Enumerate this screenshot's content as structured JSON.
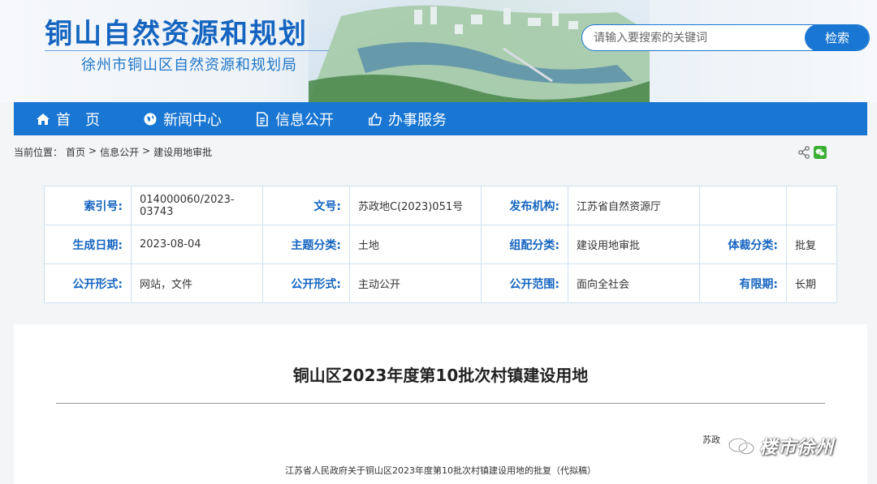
{
  "header": {
    "site_title": "铜山自然资源和规划",
    "site_subtitle": "徐州市铜山区自然资源和规划局"
  },
  "search": {
    "placeholder": "请输入要搜索的关键词",
    "button_label": "检索"
  },
  "nav": {
    "items": [
      {
        "label": "首　页",
        "icon": "home-icon"
      },
      {
        "label": "新闻中心",
        "icon": "globe-icon"
      },
      {
        "label": "信息公开",
        "icon": "document-icon"
      },
      {
        "label": "办事服务",
        "icon": "thumbs-up-icon"
      }
    ]
  },
  "breadcrumb": {
    "prefix": "当前位置：",
    "items": [
      "首页",
      "信息公开",
      "建设用地审批"
    ],
    "separator": ">"
  },
  "meta": {
    "rows": [
      [
        {
          "k": "索引号:",
          "v": "014000060/2023-03743"
        },
        {
          "k": "文号:",
          "v": "苏政地C(2023)051号"
        },
        {
          "k": "发布机构:",
          "v": "江苏省自然资源厅"
        },
        {
          "k": "",
          "v": ""
        }
      ],
      [
        {
          "k": "生成日期:",
          "v": "2023-08-04"
        },
        {
          "k": "主题分类:",
          "v": "土地"
        },
        {
          "k": "组配分类:",
          "v": "建设用地审批"
        },
        {
          "k": "体裁分类:",
          "v": "批复"
        }
      ],
      [
        {
          "k": "公开形式:",
          "v": "网站，文件"
        },
        {
          "k": "公开形式:",
          "v": "主动公开"
        },
        {
          "k": "公开范围:",
          "v": "面向全社会"
        },
        {
          "k": "有限期:",
          "v": "长期"
        }
      ]
    ]
  },
  "article": {
    "title": "铜山区2023年度第10批次村镇建设用地",
    "doc_no": "苏政",
    "subtitle": "江苏省人民政府关于铜山区2023年度第10批次村镇建设用地的批复（代拟稿）"
  },
  "watermark": {
    "text": "楼市徐州"
  },
  "colors": {
    "primary": "#1976d2",
    "title_blue": "#1565c0",
    "table_border": "#cfe0f1"
  }
}
